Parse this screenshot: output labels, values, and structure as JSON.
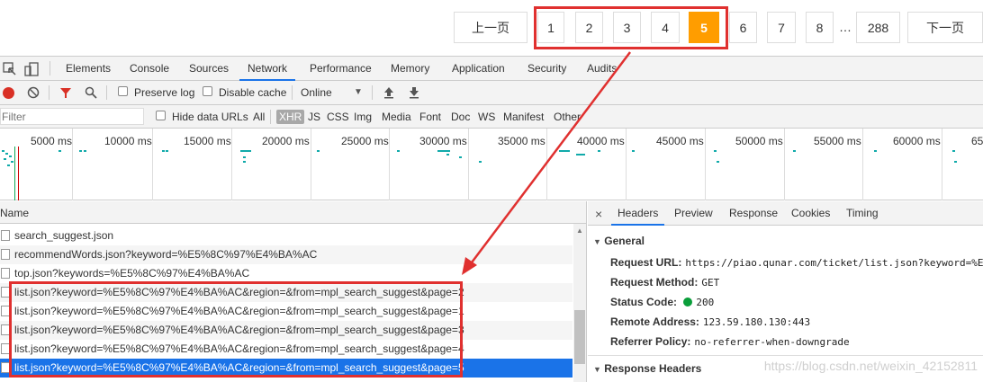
{
  "pagination": {
    "prev": "上一页",
    "pages": [
      "1",
      "2",
      "3",
      "4",
      "5",
      "6",
      "7",
      "8"
    ],
    "active": "5",
    "ellipsis": "…",
    "last": "288",
    "next": "下一页"
  },
  "devtools": {
    "tabs": [
      "Elements",
      "Console",
      "Sources",
      "Network",
      "Performance",
      "Memory",
      "Application",
      "Security",
      "Audits"
    ],
    "active_tab": "Network",
    "toolbar": {
      "preserve_log": "Preserve log",
      "disable_cache": "Disable cache",
      "throttle": "Online"
    },
    "filter": {
      "placeholder": "Filter",
      "hide_data_urls": "Hide data URLs",
      "types": [
        "All",
        "XHR",
        "JS",
        "CSS",
        "Img",
        "Media",
        "Font",
        "Doc",
        "WS",
        "Manifest",
        "Other"
      ],
      "active_type": "XHR"
    },
    "timeline_labels": [
      "5000 ms",
      "10000 ms",
      "15000 ms",
      "20000 ms",
      "25000 ms",
      "30000 ms",
      "35000 ms",
      "40000 ms",
      "45000 ms",
      "50000 ms",
      "55000 ms",
      "60000 ms",
      "65"
    ],
    "list": {
      "header": "Name",
      "rows": [
        "search_suggest.json",
        "recommendWords.json?keyword=%E5%8C%97%E4%BA%AC",
        "top.json?keywords=%E5%8C%97%E4%BA%AC",
        "list.json?keyword=%E5%8C%97%E4%BA%AC&region=&from=mpl_search_suggest&page=2",
        "list.json?keyword=%E5%8C%97%E4%BA%AC&region=&from=mpl_search_suggest&page=1",
        "list.json?keyword=%E5%8C%97%E4%BA%AC&region=&from=mpl_search_suggest&page=3",
        "list.json?keyword=%E5%8C%97%E4%BA%AC&region=&from=mpl_search_suggest&page=4",
        "list.json?keyword=%E5%8C%97%E4%BA%AC&region=&from=mpl_search_suggest&page=5"
      ]
    },
    "detail": {
      "close": "×",
      "tabs": [
        "Headers",
        "Preview",
        "Response",
        "Cookies",
        "Timing"
      ],
      "active_tab": "Headers",
      "general_title": "General",
      "fields": [
        {
          "key": "Request URL:",
          "value": "https://piao.qunar.com/ticket/list.json?keyword=%E5"
        },
        {
          "key": "Request Method:",
          "value": "GET"
        },
        {
          "key": "Status Code:",
          "value": "200"
        },
        {
          "key": "Remote Address:",
          "value": "123.59.180.130:443"
        },
        {
          "key": "Referrer Policy:",
          "value": "no-referrer-when-downgrade"
        }
      ],
      "response_headers_title": "Response Headers"
    },
    "watermark": "https://blog.csdn.net/weixin_42152811"
  },
  "colors": {
    "active_page": "#ff9d00",
    "annotation_red": "#e0302f",
    "selected_row": "#1a73e8",
    "status_green": "#0a9e3a"
  }
}
